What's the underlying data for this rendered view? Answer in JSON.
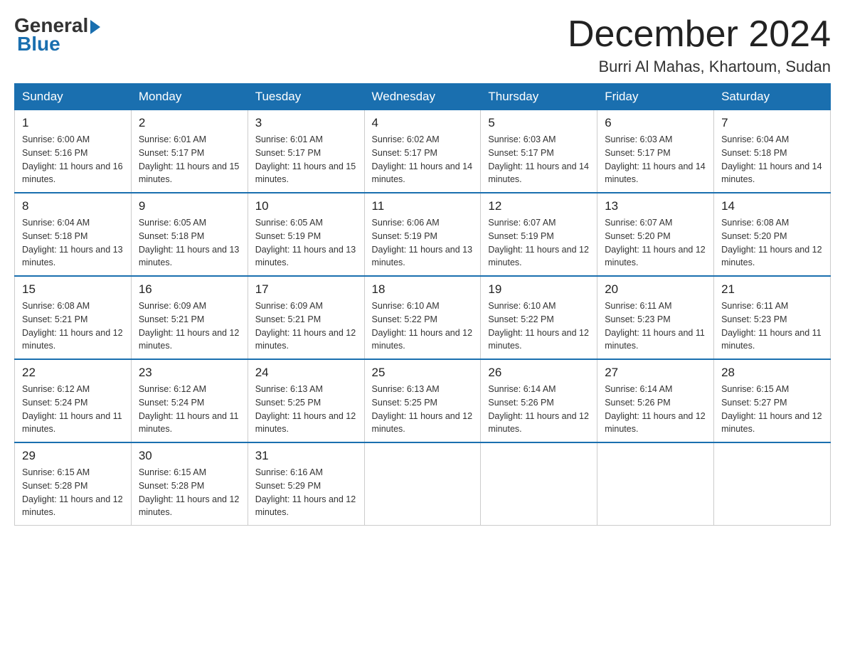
{
  "header": {
    "logo": {
      "general": "General",
      "blue": "Blue"
    },
    "title": "December 2024",
    "subtitle": "Burri Al Mahas, Khartoum, Sudan"
  },
  "weekdays": [
    "Sunday",
    "Monday",
    "Tuesday",
    "Wednesday",
    "Thursday",
    "Friday",
    "Saturday"
  ],
  "weeks": [
    [
      {
        "day": "1",
        "sunrise": "6:00 AM",
        "sunset": "5:16 PM",
        "daylight": "11 hours and 16 minutes."
      },
      {
        "day": "2",
        "sunrise": "6:01 AM",
        "sunset": "5:17 PM",
        "daylight": "11 hours and 15 minutes."
      },
      {
        "day": "3",
        "sunrise": "6:01 AM",
        "sunset": "5:17 PM",
        "daylight": "11 hours and 15 minutes."
      },
      {
        "day": "4",
        "sunrise": "6:02 AM",
        "sunset": "5:17 PM",
        "daylight": "11 hours and 14 minutes."
      },
      {
        "day": "5",
        "sunrise": "6:03 AM",
        "sunset": "5:17 PM",
        "daylight": "11 hours and 14 minutes."
      },
      {
        "day": "6",
        "sunrise": "6:03 AM",
        "sunset": "5:17 PM",
        "daylight": "11 hours and 14 minutes."
      },
      {
        "day": "7",
        "sunrise": "6:04 AM",
        "sunset": "5:18 PM",
        "daylight": "11 hours and 14 minutes."
      }
    ],
    [
      {
        "day": "8",
        "sunrise": "6:04 AM",
        "sunset": "5:18 PM",
        "daylight": "11 hours and 13 minutes."
      },
      {
        "day": "9",
        "sunrise": "6:05 AM",
        "sunset": "5:18 PM",
        "daylight": "11 hours and 13 minutes."
      },
      {
        "day": "10",
        "sunrise": "6:05 AM",
        "sunset": "5:19 PM",
        "daylight": "11 hours and 13 minutes."
      },
      {
        "day": "11",
        "sunrise": "6:06 AM",
        "sunset": "5:19 PM",
        "daylight": "11 hours and 13 minutes."
      },
      {
        "day": "12",
        "sunrise": "6:07 AM",
        "sunset": "5:19 PM",
        "daylight": "11 hours and 12 minutes."
      },
      {
        "day": "13",
        "sunrise": "6:07 AM",
        "sunset": "5:20 PM",
        "daylight": "11 hours and 12 minutes."
      },
      {
        "day": "14",
        "sunrise": "6:08 AM",
        "sunset": "5:20 PM",
        "daylight": "11 hours and 12 minutes."
      }
    ],
    [
      {
        "day": "15",
        "sunrise": "6:08 AM",
        "sunset": "5:21 PM",
        "daylight": "11 hours and 12 minutes."
      },
      {
        "day": "16",
        "sunrise": "6:09 AM",
        "sunset": "5:21 PM",
        "daylight": "11 hours and 12 minutes."
      },
      {
        "day": "17",
        "sunrise": "6:09 AM",
        "sunset": "5:21 PM",
        "daylight": "11 hours and 12 minutes."
      },
      {
        "day": "18",
        "sunrise": "6:10 AM",
        "sunset": "5:22 PM",
        "daylight": "11 hours and 12 minutes."
      },
      {
        "day": "19",
        "sunrise": "6:10 AM",
        "sunset": "5:22 PM",
        "daylight": "11 hours and 12 minutes."
      },
      {
        "day": "20",
        "sunrise": "6:11 AM",
        "sunset": "5:23 PM",
        "daylight": "11 hours and 11 minutes."
      },
      {
        "day": "21",
        "sunrise": "6:11 AM",
        "sunset": "5:23 PM",
        "daylight": "11 hours and 11 minutes."
      }
    ],
    [
      {
        "day": "22",
        "sunrise": "6:12 AM",
        "sunset": "5:24 PM",
        "daylight": "11 hours and 11 minutes."
      },
      {
        "day": "23",
        "sunrise": "6:12 AM",
        "sunset": "5:24 PM",
        "daylight": "11 hours and 11 minutes."
      },
      {
        "day": "24",
        "sunrise": "6:13 AM",
        "sunset": "5:25 PM",
        "daylight": "11 hours and 12 minutes."
      },
      {
        "day": "25",
        "sunrise": "6:13 AM",
        "sunset": "5:25 PM",
        "daylight": "11 hours and 12 minutes."
      },
      {
        "day": "26",
        "sunrise": "6:14 AM",
        "sunset": "5:26 PM",
        "daylight": "11 hours and 12 minutes."
      },
      {
        "day": "27",
        "sunrise": "6:14 AM",
        "sunset": "5:26 PM",
        "daylight": "11 hours and 12 minutes."
      },
      {
        "day": "28",
        "sunrise": "6:15 AM",
        "sunset": "5:27 PM",
        "daylight": "11 hours and 12 minutes."
      }
    ],
    [
      {
        "day": "29",
        "sunrise": "6:15 AM",
        "sunset": "5:28 PM",
        "daylight": "11 hours and 12 minutes."
      },
      {
        "day": "30",
        "sunrise": "6:15 AM",
        "sunset": "5:28 PM",
        "daylight": "11 hours and 12 minutes."
      },
      {
        "day": "31",
        "sunrise": "6:16 AM",
        "sunset": "5:29 PM",
        "daylight": "11 hours and 12 minutes."
      },
      null,
      null,
      null,
      null
    ]
  ]
}
